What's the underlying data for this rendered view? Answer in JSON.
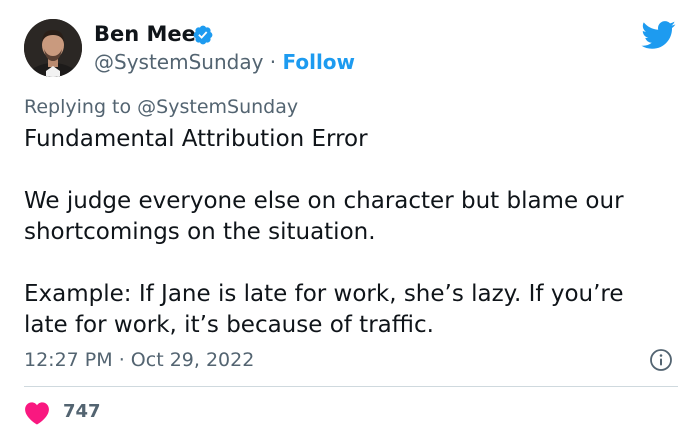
{
  "author": {
    "display_name": "Ben Meer",
    "handle": "@SystemSunday",
    "separator": "·",
    "follow_label": "Follow"
  },
  "tweet": {
    "replying_prefix": "Replying to",
    "replying_to": "@SystemSunday",
    "lines": [
      "Fundamental Attribution Error",
      "We judge everyone else on character but blame our shortcomings on the situation.",
      "Example: If Jane is late for work, she’s lazy. If you’re late for work, it’s because of traffic."
    ],
    "time": "12:27 PM",
    "separator": "·",
    "date": "Oct 29, 2022",
    "likes": "747"
  },
  "icons": {
    "verified": "verified-badge-icon",
    "brand": "twitter-bird-icon",
    "info": "info-icon",
    "like": "heart-icon"
  },
  "colors": {
    "accent": "#1d9bf0",
    "like": "#f91880",
    "text_primary": "#0f1419",
    "text_secondary": "#536471",
    "divider": "#cfd9de"
  }
}
